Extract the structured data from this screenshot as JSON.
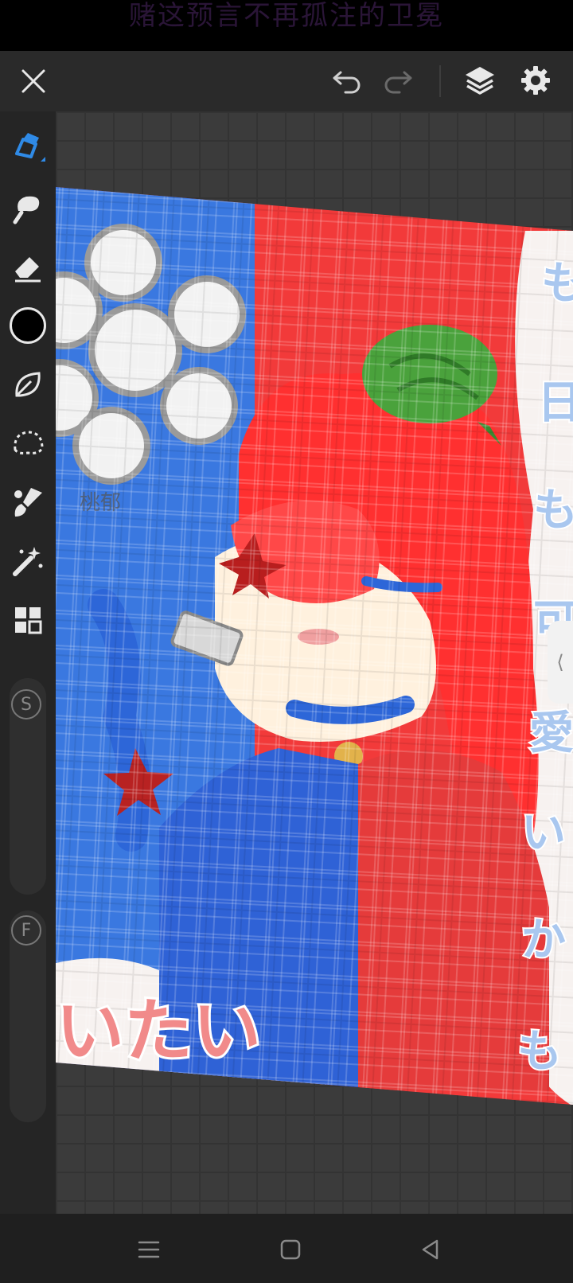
{
  "status_bar": {
    "text": "赌这预言不再孤注的卫冕"
  },
  "toolbar": {
    "close_icon": "close-icon",
    "undo_icon": "undo-icon",
    "redo_icon": "redo-icon",
    "layers_icon": "layers-icon",
    "settings_icon": "gear-icon"
  },
  "tools": [
    {
      "name": "pen-tool",
      "active": true
    },
    {
      "name": "smudge-tool"
    },
    {
      "name": "eraser-tool"
    },
    {
      "name": "color-swatch",
      "color": "#000000"
    },
    {
      "name": "leaf-brush-tool"
    },
    {
      "name": "lasso-tool"
    },
    {
      "name": "fill-brush-tool"
    },
    {
      "name": "magic-wand-tool"
    },
    {
      "name": "grid-tool"
    }
  ],
  "size_slider": {
    "label": "S"
  },
  "opacity_slider": {
    "label": "F"
  },
  "artwork": {
    "right_text": [
      "も",
      "日",
      "も",
      "可",
      "愛",
      "い",
      "か",
      "も"
    ],
    "bottom_text": "いたい",
    "signature": "桃郁"
  },
  "side_handle": {
    "label": "⟨"
  },
  "colors": {
    "accent": "#2f8ae6",
    "red": "#f23636",
    "blue": "#2d66d8"
  }
}
